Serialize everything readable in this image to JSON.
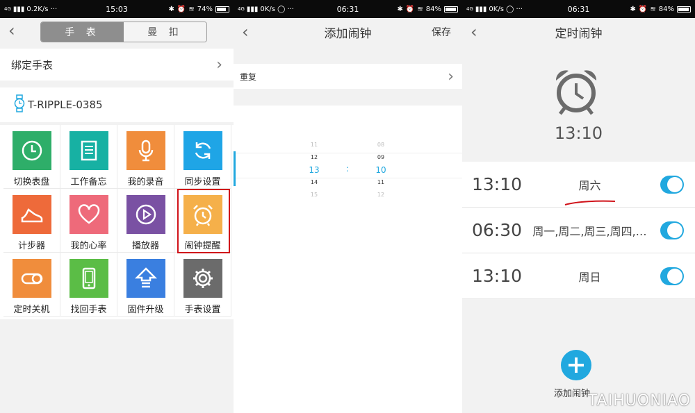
{
  "screen1": {
    "status": {
      "network": "4G",
      "speed": "0.2K/s ···",
      "time": "15:03",
      "battery": "74%",
      "battery_level": 0.74
    },
    "tabs": [
      "手 表",
      "曼 扣"
    ],
    "bind_label": "绑定手表",
    "device_name": "T-RIPPLE-0385",
    "grid": [
      {
        "label": "切换表盘",
        "icon": "clock-icon",
        "color": "#2eae69"
      },
      {
        "label": "工作备忘",
        "icon": "memo-icon",
        "color": "#17b1a3"
      },
      {
        "label": "我的录音",
        "icon": "microphone-icon",
        "color": "#f08d3c"
      },
      {
        "label": "同步设置",
        "icon": "sync-icon",
        "color": "#1fa5e6"
      },
      {
        "label": "计步器",
        "icon": "shoe-icon",
        "color": "#ee6a3a"
      },
      {
        "label": "我的心率",
        "icon": "heart-icon",
        "color": "#ee6a7a"
      },
      {
        "label": "播放器",
        "icon": "play-icon",
        "color": "#7a51a3"
      },
      {
        "label": "闹钟提醒",
        "icon": "alarm-icon",
        "color": "#f5b04a"
      },
      {
        "label": "定时关机",
        "icon": "toggle-icon",
        "color": "#f08d3c"
      },
      {
        "label": "找回手表",
        "icon": "phone-icon",
        "color": "#5bbd46"
      },
      {
        "label": "固件升级",
        "icon": "upgrade-icon",
        "color": "#3a7fe0"
      },
      {
        "label": "手表设置",
        "icon": "gear-icon",
        "color": "#6b6b6b"
      }
    ]
  },
  "screen2": {
    "status": {
      "network": "4G",
      "speed": "0K/s ◯ ···",
      "time": "06:31",
      "battery": "84%",
      "battery_level": 0.84
    },
    "title": "添加闹钟",
    "save": "保存",
    "repeat_label": "重复",
    "hours": [
      "11",
      "12",
      "13",
      "14",
      "15"
    ],
    "minutes": [
      "08",
      "09",
      "10",
      "11",
      "12"
    ],
    "separator": ":"
  },
  "screen3": {
    "status": {
      "network": "4G",
      "speed": "0K/s ◯ ···",
      "time": "06:31",
      "battery": "84%",
      "battery_level": 0.84
    },
    "title": "定时闹钟",
    "big_time": "13:10",
    "alarms": [
      {
        "time": "13:10",
        "days": "周六",
        "on": true
      },
      {
        "time": "06:30",
        "days": "周一,周二,周三,周四,…",
        "on": true
      },
      {
        "time": "13:10",
        "days": "周日",
        "on": true
      }
    ],
    "add_label": "添加闹钟"
  },
  "watermark": "TAIHUONIAO"
}
